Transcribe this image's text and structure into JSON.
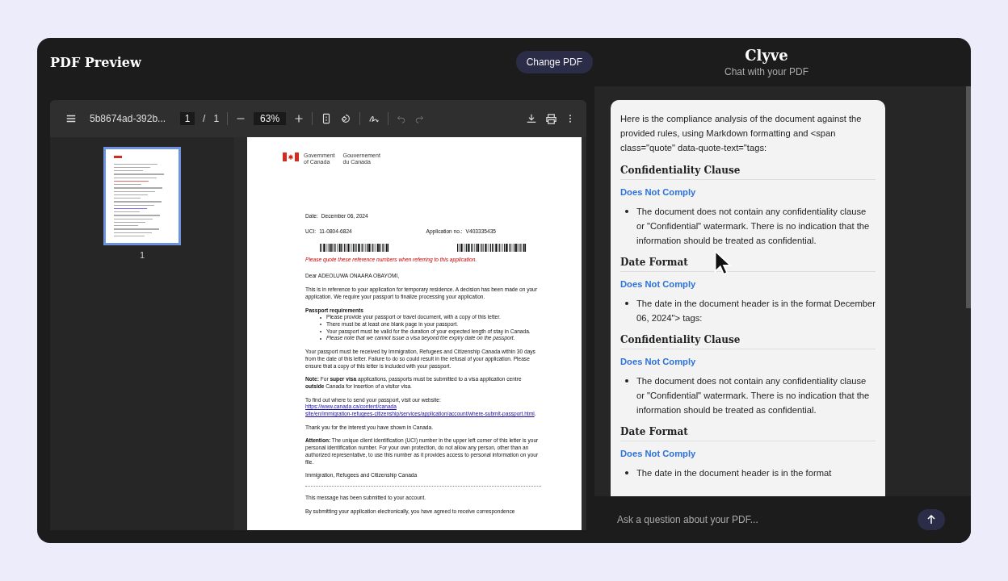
{
  "header": {
    "title": "PDF Preview",
    "change_button": "Change PDF",
    "brand": "Clyve",
    "tagline": "Chat with your PDF"
  },
  "toolbar": {
    "filename": "5b8674ad-392b...",
    "page": "1",
    "separator": "/",
    "total": "1",
    "zoom": "63%"
  },
  "thumbnails": [
    {
      "label": "1",
      "selected": true
    }
  ],
  "document": {
    "agency_en": [
      "Government",
      "of Canada"
    ],
    "agency_fr": [
      "Gouvernement",
      "du Canada"
    ],
    "date_label": "Date:",
    "date": "December 06, 2024",
    "uci_label": "UCI:",
    "uci": "11-0804-6824",
    "app_label": "Application no.:",
    "app_no": "V403335435",
    "notice": "Please quote these reference numbers when referring to this application.",
    "blocks": [
      {
        "kind": "paragraph",
        "text": "Dear  ADEOLUWA ONAARA OBAYOMI,"
      },
      {
        "kind": "paragraph",
        "text": "This is in reference to your application for temporary residence. A decision has been made on your application. We require your passport to finalize processing your application."
      },
      {
        "kind": "list",
        "heading": "Passport requirements",
        "items": [
          "Please provide your passport or travel document, with a copy of this letter.",
          "There must be at least one blank page in your passport.",
          "Your passport must be valid for the duration of your expected length of stay in Canada.",
          "*Please note that we cannot issue a visa beyond the expiry date on the passport.*"
        ]
      },
      {
        "kind": "paragraph",
        "text": "Your passport must be received by Immigration, Refugees and Citizenship Canada within 30 days from the date of this letter. Failure to do so could result in the refusal of your application. Please ensure that a copy of this letter is included with your passport."
      },
      {
        "kind": "paragraph",
        "text": "**Note:** For **super visa** applications, passports must be submitted to a visa application centre **outside** Canada for insertion of a visitor visa."
      },
      {
        "kind": "link",
        "text": "To find out where to send your passport, visit our website:",
        "links": [
          "https://www.canada.ca/content/canada",
          "site/en/immigration-refugees-citizenship/services/application/account/where-submit-passport.html"
        ],
        "end": "."
      },
      {
        "kind": "paragraph",
        "text": "Thank you for the interest you have shown in Canada."
      },
      {
        "kind": "paragraph",
        "text": "**Attention:**  The unique client identification (UCI) number in the upper left corner of this letter is your personal identification number. For your own protection, do not allow any person, other than an authorized representative, to use this number as it provides access to personal information on your file."
      },
      {
        "kind": "paragraph",
        "text": "Immigration, Refugees and Citizenship Canada"
      },
      {
        "kind": "rule"
      },
      {
        "kind": "paragraph",
        "text": "This message has been submitted to your account."
      },
      {
        "kind": "paragraph",
        "text": "By submitting your application electronically, you have agreed to receive correspondence"
      }
    ]
  },
  "chat": {
    "intro": "Here is the compliance analysis of the document against the provided rules, using Markdown formatting and <span class=\"quote\" data-quote-text=\"tags:",
    "sections": [
      {
        "heading": "Confidentiality Clause",
        "status": "Does Not Comply",
        "bullets": [
          "The document does not contain any confidentiality clause or \"Confidential\" watermark. There is no indication that the information should be treated as confidential."
        ]
      },
      {
        "heading": "Date Format",
        "status": "Does Not Comply",
        "bullets": [
          "The date in the document header is in the format December 06, 2024\"> tags:"
        ]
      },
      {
        "heading": "Confidentiality Clause",
        "status": "Does Not Comply",
        "bullets": [
          "The document does not contain any confidentiality clause or \"Confidential\" watermark. There is no indication that the information should be treated as confidential."
        ]
      },
      {
        "heading": "Date Format",
        "status": "Does Not Comply",
        "bullets": [
          "The date in the document header is in the format"
        ]
      }
    ],
    "placeholder": "Ask a question about your PDF..."
  }
}
